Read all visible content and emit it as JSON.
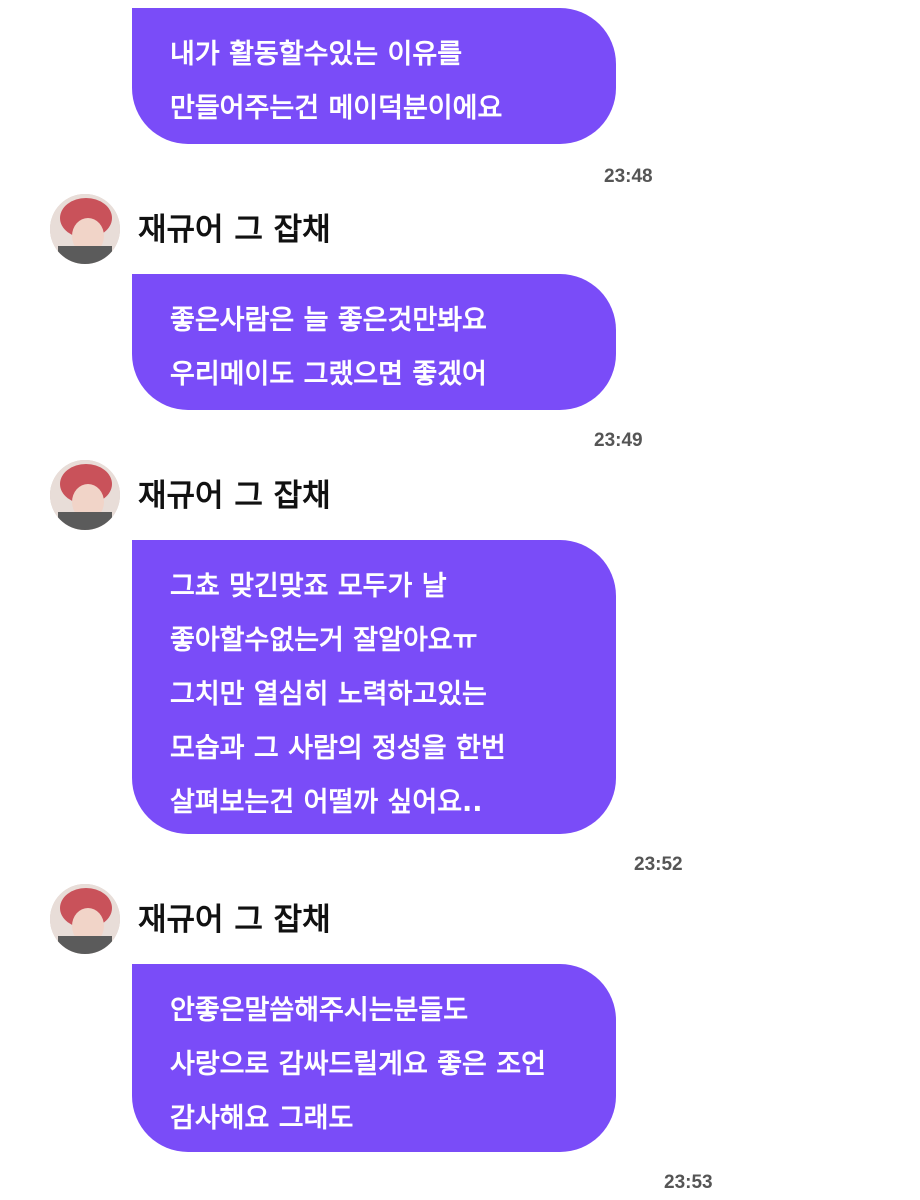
{
  "messages": [
    {
      "lines": [
        "내가 활동할수있는 이유를",
        "만들어주는건 메이덕분이에요"
      ],
      "time": "23:48"
    },
    {
      "sender": "재규어 그 잡채",
      "lines": [
        "좋은사람은 늘 좋은것만봐요",
        "우리메이도 그랬으면 좋겠어"
      ],
      "time": "23:49"
    },
    {
      "sender": "재규어 그 잡채",
      "lines": [
        "그쵸 맞긴맞죠 모두가 날",
        "좋아할수없는거 잘알아요ㅠ",
        "그치만 열심히 노력하고있는",
        "모습과 그 사람의 정성을 한번",
        "살펴보는건 어떨까 싶어요.."
      ],
      "time": "23:52"
    },
    {
      "sender": "재규어 그 잡채",
      "lines": [
        "안좋은말씀해주시는분들도",
        "사랑으로 감싸드릴게요 좋은 조언",
        "감사해요 그래도"
      ],
      "time": "23:53"
    }
  ],
  "colors": {
    "bubble": "#7a4cf8",
    "bubble_text": "#ffffff",
    "time": "#555555"
  },
  "icons": {
    "avatar": "profile-photo"
  }
}
